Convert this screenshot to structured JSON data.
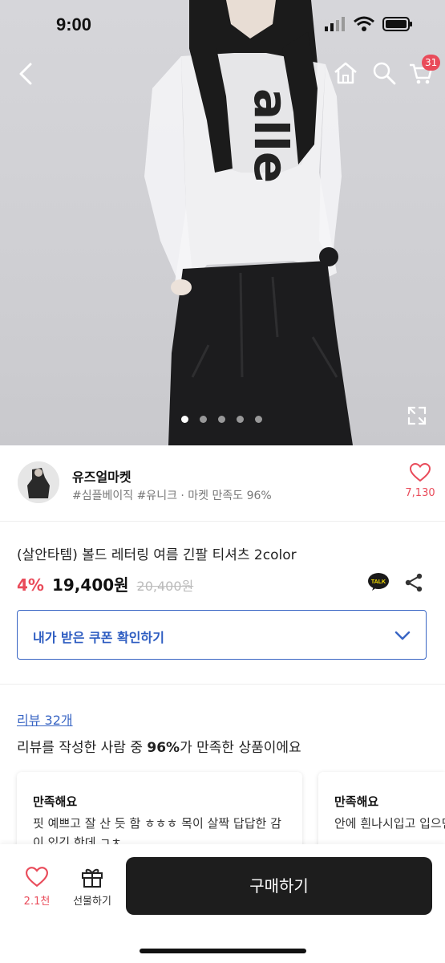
{
  "status_bar": {
    "time": "9:00"
  },
  "nav": {
    "cart_count": "31"
  },
  "gallery": {
    "total": 5,
    "active_index": 0,
    "shirt_print": "alle"
  },
  "seller": {
    "name": "유즈얼마켓",
    "meta": "#심플베이직 #유니크 · 마켓 만족도 96%",
    "likes": "7,130"
  },
  "product": {
    "title": "(살안타템) 볼드 레터링 여름 긴팔 티셔츠 2color",
    "discount": "4%",
    "price": "19,400원",
    "original_price": "20,400원"
  },
  "talk_label": "TALK",
  "coupon": {
    "label": "내가 받은 쿠폰 확인하기"
  },
  "reviews": {
    "link": "리뷰 32개",
    "summary_prefix": "리뷰를 작성한 사람 중 ",
    "summary_pct": "96%",
    "summary_suffix": "가 만족한 상품이에요",
    "cards": [
      {
        "title": "만족해요",
        "text": "핏 예쁘고 잘 산 듯 함 ㅎㅎㅎ 목이 살짝 답답한 감이 있긴 한데 ㄱㅊ"
      },
      {
        "title": "만족해요",
        "text": "안에 흰나시입고 입으면 스타일"
      }
    ]
  },
  "bottom": {
    "wish_count": "2.1천",
    "gift_label": "선물하기",
    "buy_label": "구매하기"
  },
  "colors": {
    "accent_red": "#e94b5a",
    "link_blue": "#3a66c4",
    "buy_bg": "#1d1d1d"
  }
}
